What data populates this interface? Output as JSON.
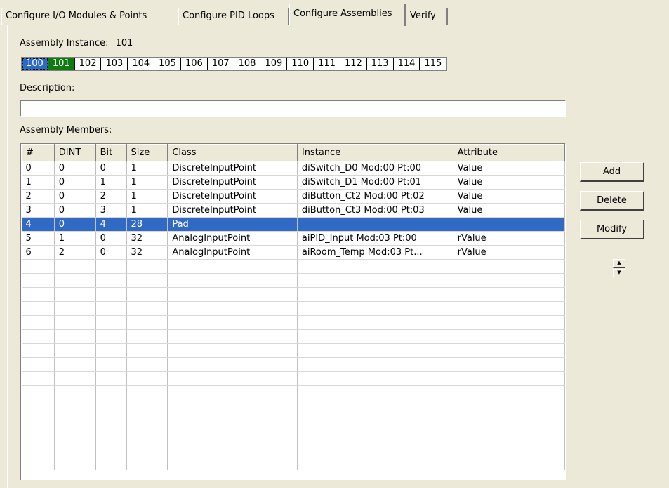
{
  "tabs": [
    {
      "label": "Configure I/O Modules & Points"
    },
    {
      "label": "Configure PID Loops"
    },
    {
      "label": "Configure Assemblies"
    },
    {
      "label": "Verify"
    }
  ],
  "active_tab": "Configure Assemblies",
  "assembly_instance": {
    "label": "Assembly Instance:",
    "value": "101",
    "options": [
      "100",
      "101",
      "102",
      "103",
      "104",
      "105",
      "106",
      "107",
      "108",
      "109",
      "110",
      "111",
      "112",
      "113",
      "114",
      "115"
    ],
    "focused": "100",
    "selected": "101"
  },
  "description": {
    "label": "Description:",
    "value": ""
  },
  "members": {
    "label": "Assembly Members:",
    "columns": [
      "#",
      "DINT",
      "Bit",
      "Size",
      "Class",
      "Instance",
      "Attribute"
    ],
    "rows": [
      [
        "0",
        "0",
        "0",
        "1",
        "DiscreteInputPoint",
        "diSwitch_D0  Mod:00  Pt:00",
        "Value"
      ],
      [
        "1",
        "0",
        "1",
        "1",
        "DiscreteInputPoint",
        "diSwitch_D1  Mod:00  Pt:01",
        "Value"
      ],
      [
        "2",
        "0",
        "2",
        "1",
        "DiscreteInputPoint",
        "diButton_Ct2  Mod:00  Pt:02",
        "Value"
      ],
      [
        "3",
        "0",
        "3",
        "1",
        "DiscreteInputPoint",
        "diButton_Ct3  Mod:00  Pt:03",
        "Value"
      ],
      [
        "4",
        "0",
        "4",
        "28",
        "Pad",
        "",
        ""
      ],
      [
        "5",
        "1",
        "0",
        "32",
        "AnalogInputPoint",
        "aiPID_Input  Mod:03  Pt:00",
        "rValue"
      ],
      [
        "6",
        "2",
        "0",
        "32",
        "AnalogInputPoint",
        "aiRoom_Temp  Mod:03  Pt...",
        "rValue"
      ]
    ],
    "selected_row": 4
  },
  "buttons": {
    "add": "Add",
    "delete": "Delete",
    "modify": "Modify"
  },
  "spinner": {
    "up": "▲",
    "down": "▼"
  },
  "colors": {
    "selection_blue": "#316ac5",
    "instance_green": "#0f7c10",
    "dialog_bg": "#ece9d8"
  }
}
